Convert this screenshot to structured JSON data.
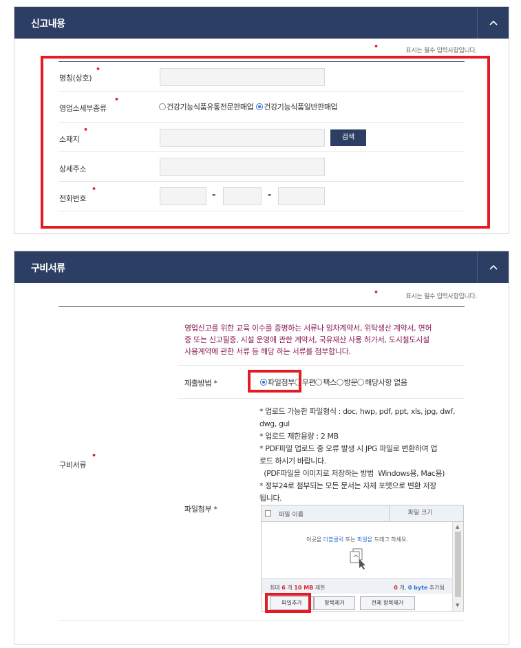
{
  "section1": {
    "title": "신고내용",
    "required_note": "표시는 필수 입력사항입니다.",
    "fields": {
      "name_label": "명칭(상호)",
      "business_type_label": "영업소세부종류",
      "business_type_options": [
        "건강기능식품유통전문판매업",
        "건강기능식품일반판매업"
      ],
      "business_type_selected": "건강기능식품일반판매업",
      "location_label": "소재지",
      "search_button": "검색",
      "detail_address_label": "상세주소",
      "phone_label": "전화번호",
      "phone_separator": "-"
    }
  },
  "section2": {
    "title": "구비서류",
    "required_note": "표시는 필수 입력사항입니다.",
    "docs_label": "구비서류",
    "notice_lines": [
      "영업신고를 위한 교육 이수를 증명하는 서류나 임차계약서, 위탁생산 계약서, 면허",
      "증 또는 신고필증, 시설 운영에 관한 계약서, 국유재산 사용 허가서, 도시철도시설",
      "사용계약에 관한 서류 등 해당 하는 서류를 첨부합니다."
    ],
    "submit_method_label": "제출방법 *",
    "submit_options": [
      "파일첨부",
      "우편",
      "팩스",
      "방문",
      "해당사항 없음"
    ],
    "submit_selected": "파일첨부",
    "attach_label": "파일첨부 *",
    "guide_lines": [
      "* 업로드 가능한 파일형식 : doc, hwp, pdf, ppt, xls, jpg, dwf,",
      "dwg, gul",
      "* 업로드 제한용량 : 2 MB",
      "* PDF파일 업로드 중 오류 발생 시 JPG 파일로 변환하여 업",
      "로드 하시기 바랍니다.",
      "  (PDF파일을 이미지로 저장하는 방법  Windows용, Mac용)",
      "* 정부24로 첨부되는 모든 문서는 자체 포맷으로 변환 저장",
      "됩니다."
    ],
    "uploader": {
      "col_name": "파일 이름",
      "col_size": "파일 크기",
      "drop_text_pre": "이곳을 ",
      "drop_text_accent1": "더블클릭",
      "drop_text_mid": " 또는 ",
      "drop_text_accent2": "파일을",
      "drop_text_post": " 드래그 하세요.",
      "limit_prefix": "최대 ",
      "limit_count": "6",
      "limit_mid": " 개 ",
      "limit_size": "10 MB",
      "limit_suffix": " 제한",
      "current_count": "0",
      "current_mid": " 개, ",
      "current_size": "0 byte",
      "current_suffix": " 추가됨",
      "add_button": "파일추가",
      "remove_button": "항목제거",
      "remove_all_button": "전체 항목제거"
    }
  },
  "colors": {
    "header_bg": "#2c3e63",
    "highlight_red": "#e51b24",
    "required_dot": "#e0222a",
    "notice_text": "#8a1a52"
  }
}
